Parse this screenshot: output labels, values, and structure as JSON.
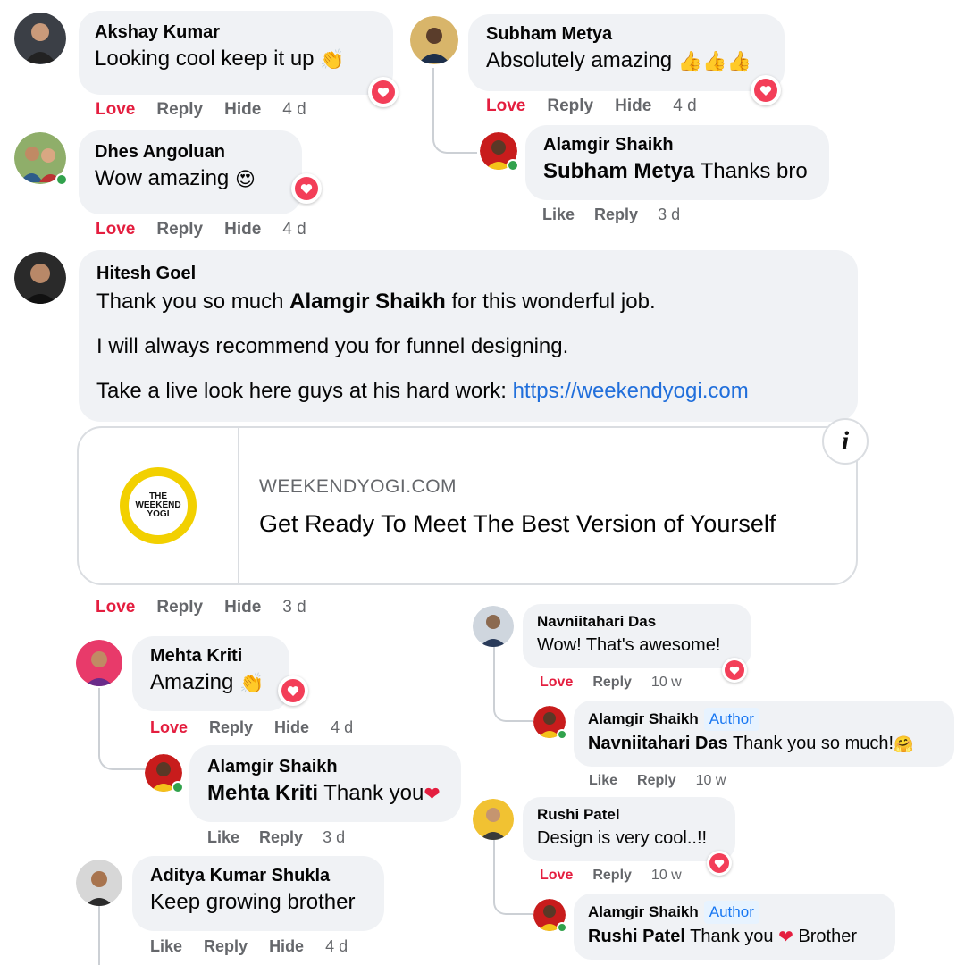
{
  "actions": {
    "love": "Love",
    "like": "Like",
    "reply": "Reply",
    "hide": "Hide"
  },
  "comments": {
    "akshay": {
      "name": "Akshay Kumar",
      "text": "Looking cool keep it up",
      "time": "4 d"
    },
    "dhes": {
      "name": "Dhes Angoluan",
      "text": "Wow amazing",
      "time": "4 d"
    },
    "subham": {
      "name": "Subham Metya",
      "text": "Absolutely amazing",
      "time": "4 d"
    },
    "subham_reply": {
      "name": "Alamgir Shaikh",
      "mention": "Subham Metya",
      "text": "Thanks bro",
      "time": "3 d"
    },
    "hitesh": {
      "name": "Hitesh Goel",
      "line1_pre": "Thank you so much",
      "line1_mention": "Alamgir Shaikh",
      "line1_post": "for this wonderful job.",
      "line2": "I will always recommend you for funnel designing.",
      "line3": "Take a live look here guys at his hard work:",
      "link": "https://weekendyogi.com",
      "time": "3 d"
    },
    "preview": {
      "domain": "WEEKENDYOGI.COM",
      "title": "Get Ready To Meet The Best Version of Yourself",
      "logo_text": "THE WEEKEND YOGI"
    },
    "mehta": {
      "name": "Mehta Kriti",
      "text": "Amazing",
      "time": "4 d"
    },
    "mehta_reply": {
      "name": "Alamgir Shaikh",
      "mention": "Mehta Kriti",
      "text": "Thank you",
      "time": "3 d"
    },
    "aditya": {
      "name": "Aditya Kumar Shukla",
      "text": "Keep growing brother",
      "time": "4 d"
    },
    "navni": {
      "name": "Navniitahari Das",
      "text": "Wow! That's awesome!",
      "time": "10 w"
    },
    "navni_reply": {
      "name": "Alamgir Shaikh",
      "author_tag": "Author",
      "mention": "Navniitahari Das",
      "text": "Thank you so much!",
      "time": "10 w"
    },
    "rushi": {
      "name": "Rushi Patel",
      "text": "Design is very cool..!!",
      "time": "10 w"
    },
    "rushi_reply": {
      "name": "Alamgir Shaikh",
      "author_tag": "Author",
      "mention": "Rushi Patel",
      "text_pre": "Thank you",
      "text_post": "Brother"
    }
  },
  "colors": {
    "love": "#e41e3f",
    "bubble": "#f0f2f5",
    "link": "#216fdb",
    "online": "#31a24c",
    "author_bg": "#e7f3ff"
  }
}
